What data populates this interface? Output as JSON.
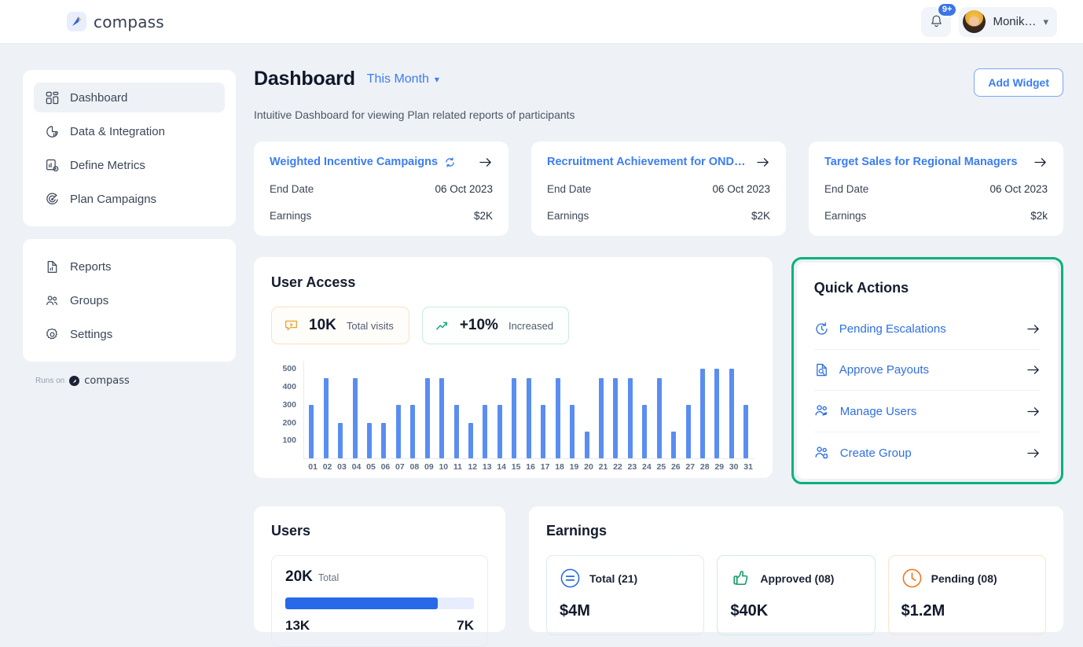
{
  "brand": {
    "name": "compass",
    "logo_icon": "compass-logo-icon"
  },
  "topbar": {
    "notifications": {
      "icon": "bell-icon",
      "badge": "9+"
    },
    "user": {
      "name": "Monik…",
      "avatar_icon": "user-avatar",
      "caret_icon": "chevron-down-icon"
    }
  },
  "sidebar": {
    "primary": [
      {
        "label": "Dashboard",
        "icon": "dashboard-icon",
        "active": true
      },
      {
        "label": "Data & Integration",
        "icon": "pie-chart-icon",
        "active": false
      },
      {
        "label": "Define Metrics",
        "icon": "metrics-settings-icon",
        "active": false
      },
      {
        "label": "Plan Campaigns",
        "icon": "target-icon",
        "active": false
      }
    ],
    "secondary": [
      {
        "label": "Reports",
        "icon": "report-document-icon"
      },
      {
        "label": "Groups",
        "icon": "groups-icon"
      },
      {
        "label": "Settings",
        "icon": "gear-icon"
      }
    ],
    "footer": {
      "prefix": "Runs on",
      "name": "compass",
      "icon": "compass-badge-icon"
    }
  },
  "header": {
    "title": "Dashboard",
    "period": "This Month",
    "period_caret_icon": "chevron-down-icon",
    "add_widget": "Add Widget",
    "subtitle": "Intuitive Dashboard for viewing Plan related reports of participants"
  },
  "campaigns": {
    "row_label_end_date": "End Date",
    "row_label_earnings": "Earnings",
    "cards": [
      {
        "title": "Weighted Incentive Campaigns",
        "sync_icon": "sync-icon",
        "arrow_icon": "arrow-right-icon",
        "end_date": "06 Oct 2023",
        "earnings": "$2K"
      },
      {
        "title": "Recruitment Achievement for OND…",
        "sync_icon": null,
        "arrow_icon": "arrow-right-icon",
        "end_date": "06 Oct 2023",
        "earnings": "$2K"
      },
      {
        "title": "Target Sales for Regional Managers",
        "sync_icon": null,
        "arrow_icon": "arrow-right-icon",
        "end_date": "06 Oct 2023",
        "earnings": "$2k"
      }
    ]
  },
  "user_access": {
    "title": "User Access",
    "chips": [
      {
        "icon": "visits-icon",
        "value": "10K",
        "label": "Total visits",
        "color": "#f0a638"
      },
      {
        "icon": "trend-up-icon",
        "value": "+10%",
        "label": "Increased",
        "color": "#12a87a"
      }
    ]
  },
  "chart_data": {
    "type": "bar",
    "title": "User Access",
    "xlabel": "",
    "ylabel": "",
    "ylim": [
      0,
      550
    ],
    "yticks": [
      100,
      200,
      300,
      400,
      500
    ],
    "grid": false,
    "legend": null,
    "bar_color": "#5a8df2",
    "categories": [
      "01",
      "02",
      "03",
      "04",
      "05",
      "06",
      "07",
      "08",
      "09",
      "10",
      "11",
      "12",
      "13",
      "14",
      "15",
      "16",
      "17",
      "18",
      "19",
      "20",
      "21",
      "22",
      "23",
      "24",
      "25",
      "26",
      "27",
      "28",
      "29",
      "30",
      "31"
    ],
    "values": [
      300,
      450,
      200,
      450,
      200,
      200,
      300,
      300,
      450,
      450,
      300,
      200,
      300,
      300,
      450,
      450,
      300,
      450,
      300,
      150,
      450,
      450,
      450,
      300,
      450,
      150,
      300,
      500,
      500,
      500,
      300
    ]
  },
  "quick_actions": {
    "title": "Quick Actions",
    "highlight_color": "#06b27c",
    "items": [
      {
        "label": "Pending Escalations",
        "icon": "clock-refresh-icon",
        "arrow_icon": "arrow-right-icon"
      },
      {
        "label": "Approve Payouts",
        "icon": "payout-document-icon",
        "arrow_icon": "arrow-right-icon"
      },
      {
        "label": "Manage Users",
        "icon": "manage-users-icon",
        "arrow_icon": "arrow-right-icon"
      },
      {
        "label": "Create Group",
        "icon": "add-user-icon",
        "arrow_icon": "arrow-right-icon"
      }
    ]
  },
  "users_panel": {
    "title": "Users",
    "total_value": "20K",
    "total_label": "Total",
    "progress_percent": 81,
    "left_value": "13K",
    "right_value": "7K"
  },
  "earnings_panel": {
    "title": "Earnings",
    "tiles": [
      {
        "label": "Total (21)",
        "value": "$4M",
        "icon": "equals-circle-icon",
        "color": "#2769e8"
      },
      {
        "label": "Approved (08)",
        "value": "$40K",
        "icon": "thumbs-up-icon",
        "color": "#0f9d63"
      },
      {
        "label": "Pending (08)",
        "value": "$1.2M",
        "icon": "clock-icon",
        "color": "#f2741c"
      }
    ]
  }
}
